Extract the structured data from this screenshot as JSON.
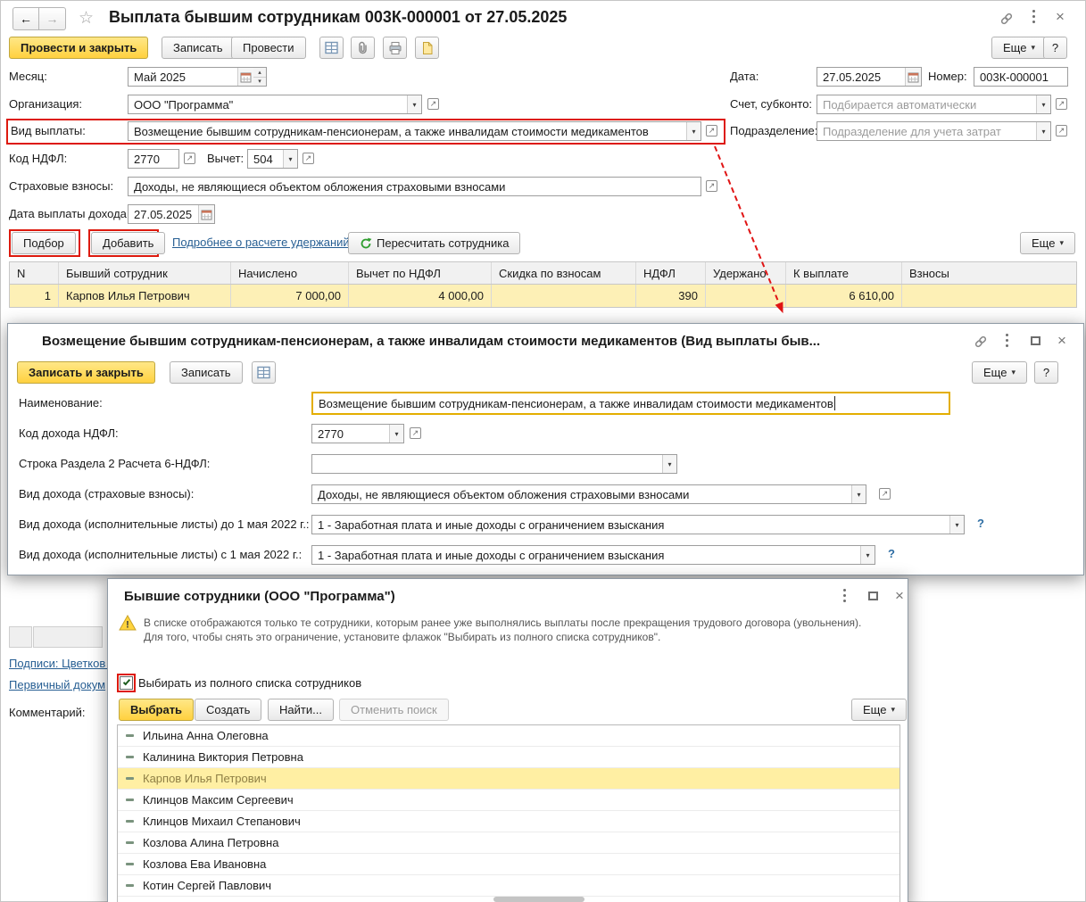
{
  "colors": {
    "accent_yellow": "#FFD743",
    "selection_yellow": "#FDF0B6",
    "alert_red": "#DD1A0E",
    "link_blue": "#265E93",
    "placeholder_gray": "#9B9B9B"
  },
  "icons": {
    "back": "←",
    "forward": "→",
    "star": "☆",
    "close": "×",
    "dropdown": "▾",
    "spin_up": "▴",
    "spin_down": "▾",
    "open_arrow": "↗",
    "more_arrow": "▾"
  },
  "main": {
    "title": "Выплата бывшим сотрудникам 003К-000001 от 27.05.2025",
    "toolbar": {
      "post_close": "Провести и закрыть",
      "save": "Записать",
      "post": "Провести",
      "more": "Еще",
      "help": "?"
    },
    "fields": {
      "month_label": "Месяц:",
      "month_value": "Май 2025",
      "date_label": "Дата:",
      "date_value": "27.05.2025",
      "number_label": "Номер:",
      "number_value": "003К-000001",
      "org_label": "Организация:",
      "org_value": "ООО \"Программа\"",
      "account_label": "Счет, субконто:",
      "account_placeholder": "Подбирается автоматически",
      "payment_type_label": "Вид выплаты:",
      "payment_type_value": "Возмещение бывшим сотрудникам-пенсионерам, а также инвалидам стоимости медикаментов",
      "division_label": "Подразделение:",
      "division_placeholder": "Подразделение для учета затрат",
      "ndfl_code_label": "Код НДФЛ:",
      "ndfl_code_value": "2770",
      "deduction_label": "Вычет:",
      "deduction_value": "504",
      "insurance_label": "Страховые взносы:",
      "insurance_value": "Доходы, не являющиеся объектом обложения страховыми взносами",
      "pay_date_label": "Дата выплаты дохода:",
      "pay_date_value": "27.05.2025"
    },
    "actions": {
      "pick": "Подбор",
      "add": "Добавить",
      "details_link": "Подробнее о расчете удержаний",
      "recalc": "Пересчитать сотрудника",
      "more": "Еще"
    },
    "table": {
      "headers": [
        "N",
        "Бывший сотрудник",
        "Начислено",
        "Вычет по НДФЛ",
        "Скидка по взносам",
        "НДФЛ",
        "Удержано",
        "К выплате",
        "Взносы"
      ],
      "rows": [
        [
          "1",
          "Карпов Илья Петрович",
          "7 000,00",
          "4 000,00",
          "",
          "390",
          "",
          "6 610,00",
          ""
        ]
      ]
    },
    "footer": {
      "signatures_link": "Подписи: Цветков С",
      "primary_doc_link": "Первичный докум",
      "comment_label": "Комментарий:"
    }
  },
  "type_form": {
    "title": "Возмещение бывшим сотрудникам-пенсионерам, а также инвалидам стоимости медикаментов (Вид выплаты быв...",
    "toolbar": {
      "save_close": "Записать и закрыть",
      "save": "Записать",
      "more": "Еще",
      "help": "?"
    },
    "fields": {
      "name_label": "Наименование:",
      "name_value": "Возмещение бывшим сотрудникам-пенсионерам, а также инвалидам стоимости медикаментов",
      "code_label": "Код дохода НДФЛ:",
      "code_value": "2770",
      "section2_label": "Строка Раздела 2 Расчета 6-НДФЛ:",
      "section2_value": "",
      "income_kind_label": "Вид дохода (страховые взносы):",
      "income_kind_value": "Доходы, не являющиеся объектом обложения страховыми взносами",
      "writ_before_label": "Вид дохода (исполнительные листы) до 1 мая 2022 г.:",
      "writ_before_value": "1 - Заработная плата и иные доходы с ограничением взыскания",
      "writ_after_label": "Вид дохода (исполнительные листы) с 1 мая 2022 г.:",
      "writ_after_value": "1 - Заработная плата и иные доходы с ограничением взыскания",
      "help_mark": "?"
    }
  },
  "employees": {
    "title": "Бывшие сотрудники (ООО \"Программа\")",
    "warning_line1": "В списке отображаются только те сотрудники, которым ранее уже выполнялись выплаты после прекращения трудового договора (увольнения).",
    "warning_line2": "Для того, чтобы снять это ограничение, установите флажок \"Выбирать из полного списка сотрудников\".",
    "checkbox_label": "Выбирать из полного списка сотрудников",
    "buttons": {
      "select": "Выбрать",
      "create": "Создать",
      "find": "Найти...",
      "cancel_search": "Отменить поиск",
      "more": "Еще"
    },
    "list": [
      "Ильина Анна Олеговна",
      "Калинина Виктория Петровна",
      "Карпов Илья Петрович",
      "Клинцов Максим Сергеевич",
      "Клинцов Михаил Степанович",
      "Козлова Алина Петровна",
      "Козлова Ева Ивановна",
      "Котин Сергей Павлович"
    ],
    "selected_employee": "Карпов Илья Петрович"
  }
}
